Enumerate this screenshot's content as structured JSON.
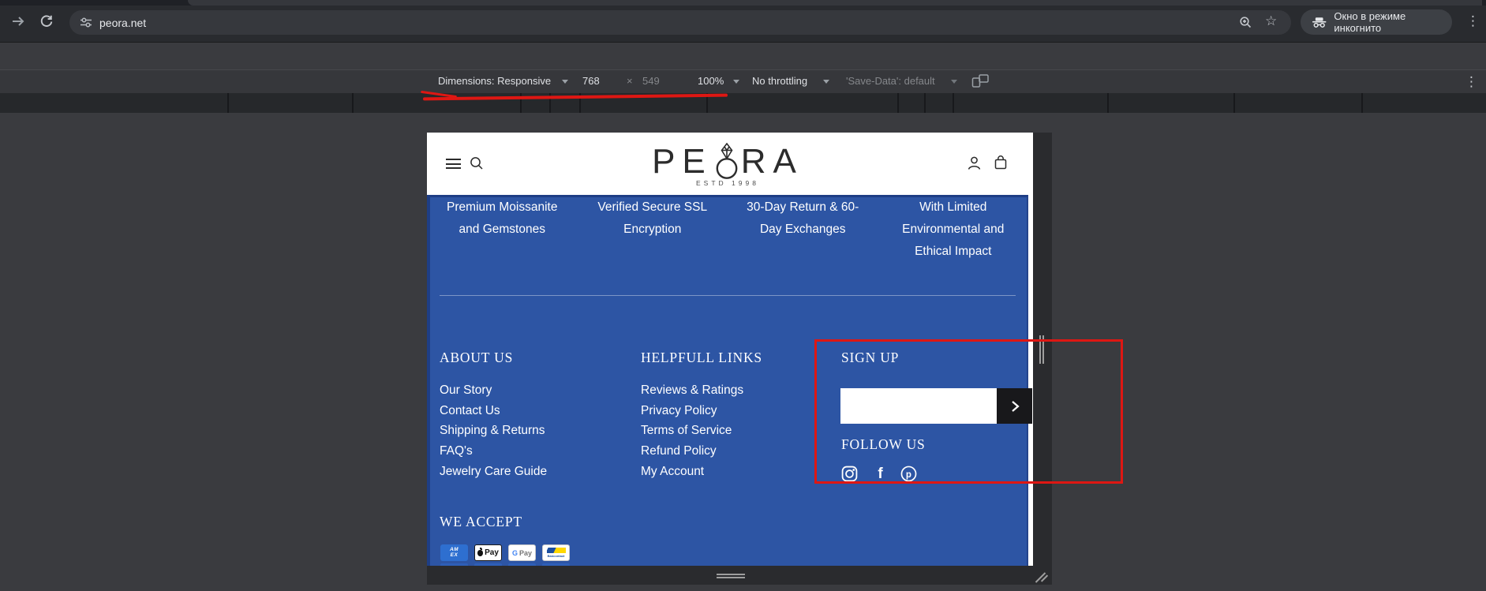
{
  "browser": {
    "url": "peora.net",
    "incognito_label": "Окно в режиме инкогнито"
  },
  "devtools": {
    "dimensions_label": "Dimensions: Responsive",
    "width_value": "768",
    "times_symbol": "×",
    "height_value": "549",
    "zoom_value": "100%",
    "throttling_value": "No throttling",
    "save_data_value": "'Save-Data': default",
    "ruler_ticks": [
      288,
      446,
      659,
      696,
      734,
      895,
      1137,
      1171,
      1207,
      1403,
      1563,
      1725
    ]
  },
  "page": {
    "header": {
      "logo_left": "PE",
      "logo_right": "RA",
      "tagline": "ESTD 1998"
    },
    "benefits": [
      {
        "lines": [
          "Premium Moissanite",
          "and Gemstones"
        ]
      },
      {
        "lines": [
          "Verified Secure SSL",
          "Encryption"
        ]
      },
      {
        "lines": [
          "30-Day Return & 60-",
          "Day Exchanges"
        ]
      },
      {
        "lines": [
          "With Limited",
          "Environmental and",
          "Ethical Impact"
        ]
      }
    ],
    "footer": {
      "about_heading": "ABOUT US",
      "about_links": [
        "Our Story",
        "Contact Us",
        "Shipping & Returns",
        "FAQ's",
        "Jewelry Care Guide"
      ],
      "helpful_heading": "HELPFULL LINKS",
      "helpful_links": [
        "Reviews & Ratings",
        "Privacy Policy",
        "Terms of Service",
        "Refund Policy",
        "My Account"
      ],
      "signup_heading": "SIGN UP",
      "follow_heading": "FOLLOW US",
      "we_accept_heading": "WE ACCEPT",
      "payments": {
        "amex_line1": "AM",
        "amex_line2": "EX",
        "apple_label": "Pay",
        "gpay_g": "G",
        "gpay_label": "Pay",
        "bancontact_label": "Bancontact"
      }
    }
  },
  "colors": {
    "page_blue": "#2d55a4",
    "annotation_red": "#de1713",
    "subscribe_button_dark": "#18181b",
    "amex_blue": "#2e6fd0",
    "bancontact_blue": "#1c4fa0",
    "bancontact_yellow": "#ffd800"
  }
}
